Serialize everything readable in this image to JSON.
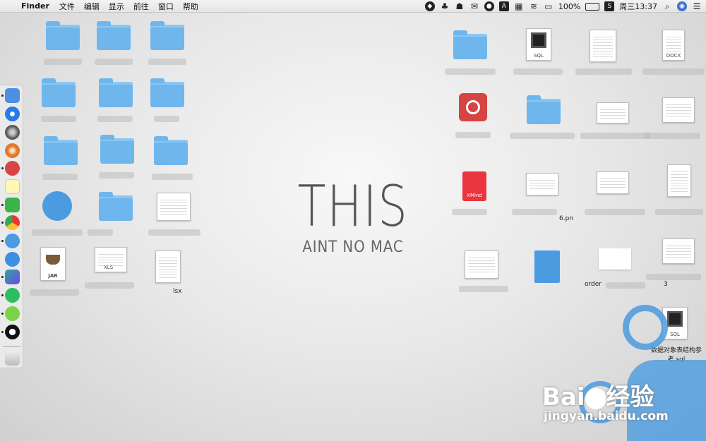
{
  "menubar": {
    "app_name": "Finder",
    "menus": [
      "文件",
      "编辑",
      "显示",
      "前往",
      "窗口",
      "帮助"
    ],
    "battery_percent": "100%",
    "battery_icon_text": "",
    "clock": "周三13:37"
  },
  "wallpaper": {
    "title": "THIS",
    "subtitle": "AINT NO MAC"
  },
  "desktop": {
    "xmind_label": "XMind",
    "jar_label": "JAR",
    "xls_tag": "XLS",
    "sql_tag": "SQL",
    "docx_tag": "DOCX",
    "partial_labels": {
      "lsx": "lsx",
      "order": "order",
      "e6": "6.pn",
      "three": "3"
    },
    "sql_file_label_line1": "数据对象表结构参",
    "sql_file_label_line2": "考.sql"
  },
  "watermark": {
    "brand": "Bai",
    "brand_cn": "经验",
    "url": "jingyan.baidu.com"
  },
  "colors": {
    "folder": "#6fb6ec",
    "netease": "#d64541",
    "xmind": "#e8353e",
    "markdown": "#4a9be0"
  }
}
